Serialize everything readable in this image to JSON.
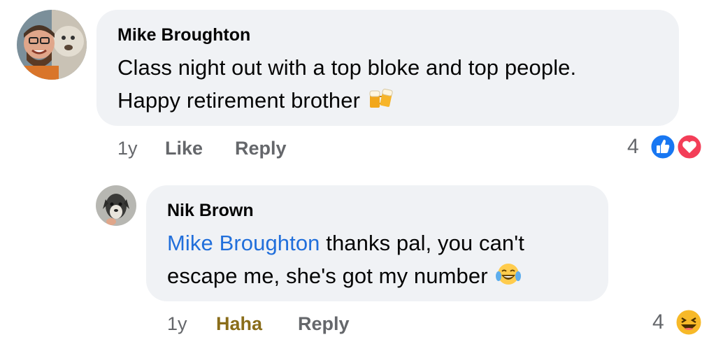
{
  "comments": [
    {
      "author": "Mike Broughton",
      "avatar": "profile-photo-man-with-glasses-and-dog",
      "lines": [
        "Class night out with a top bloke and top people.",
        "Happy retirement brother"
      ],
      "emoji": "beer-mugs-icon",
      "time": "1y",
      "like_label": "Like",
      "reply_label": "Reply",
      "reaction_count": "4",
      "reactions": [
        "like-icon",
        "love-icon"
      ]
    },
    {
      "author": "Nik Brown",
      "avatar": "profile-photo-dog",
      "mention": "Mike Broughton",
      "line1_rest": " thanks pal, you can't",
      "line2": "escape me, she's got my number",
      "emoji": "laughing-tears-icon",
      "time": "1y",
      "reaction_label": "Haha",
      "reply_label": "Reply",
      "reaction_count": "4",
      "reactions": [
        "haha-icon"
      ]
    }
  ],
  "colors": {
    "bubble": "#f0f2f5",
    "mention": "#216fdb",
    "meta": "#65676b",
    "haha": "#8a6d1a",
    "like_blue": "#1877f2",
    "love_red": "#f33e58"
  }
}
